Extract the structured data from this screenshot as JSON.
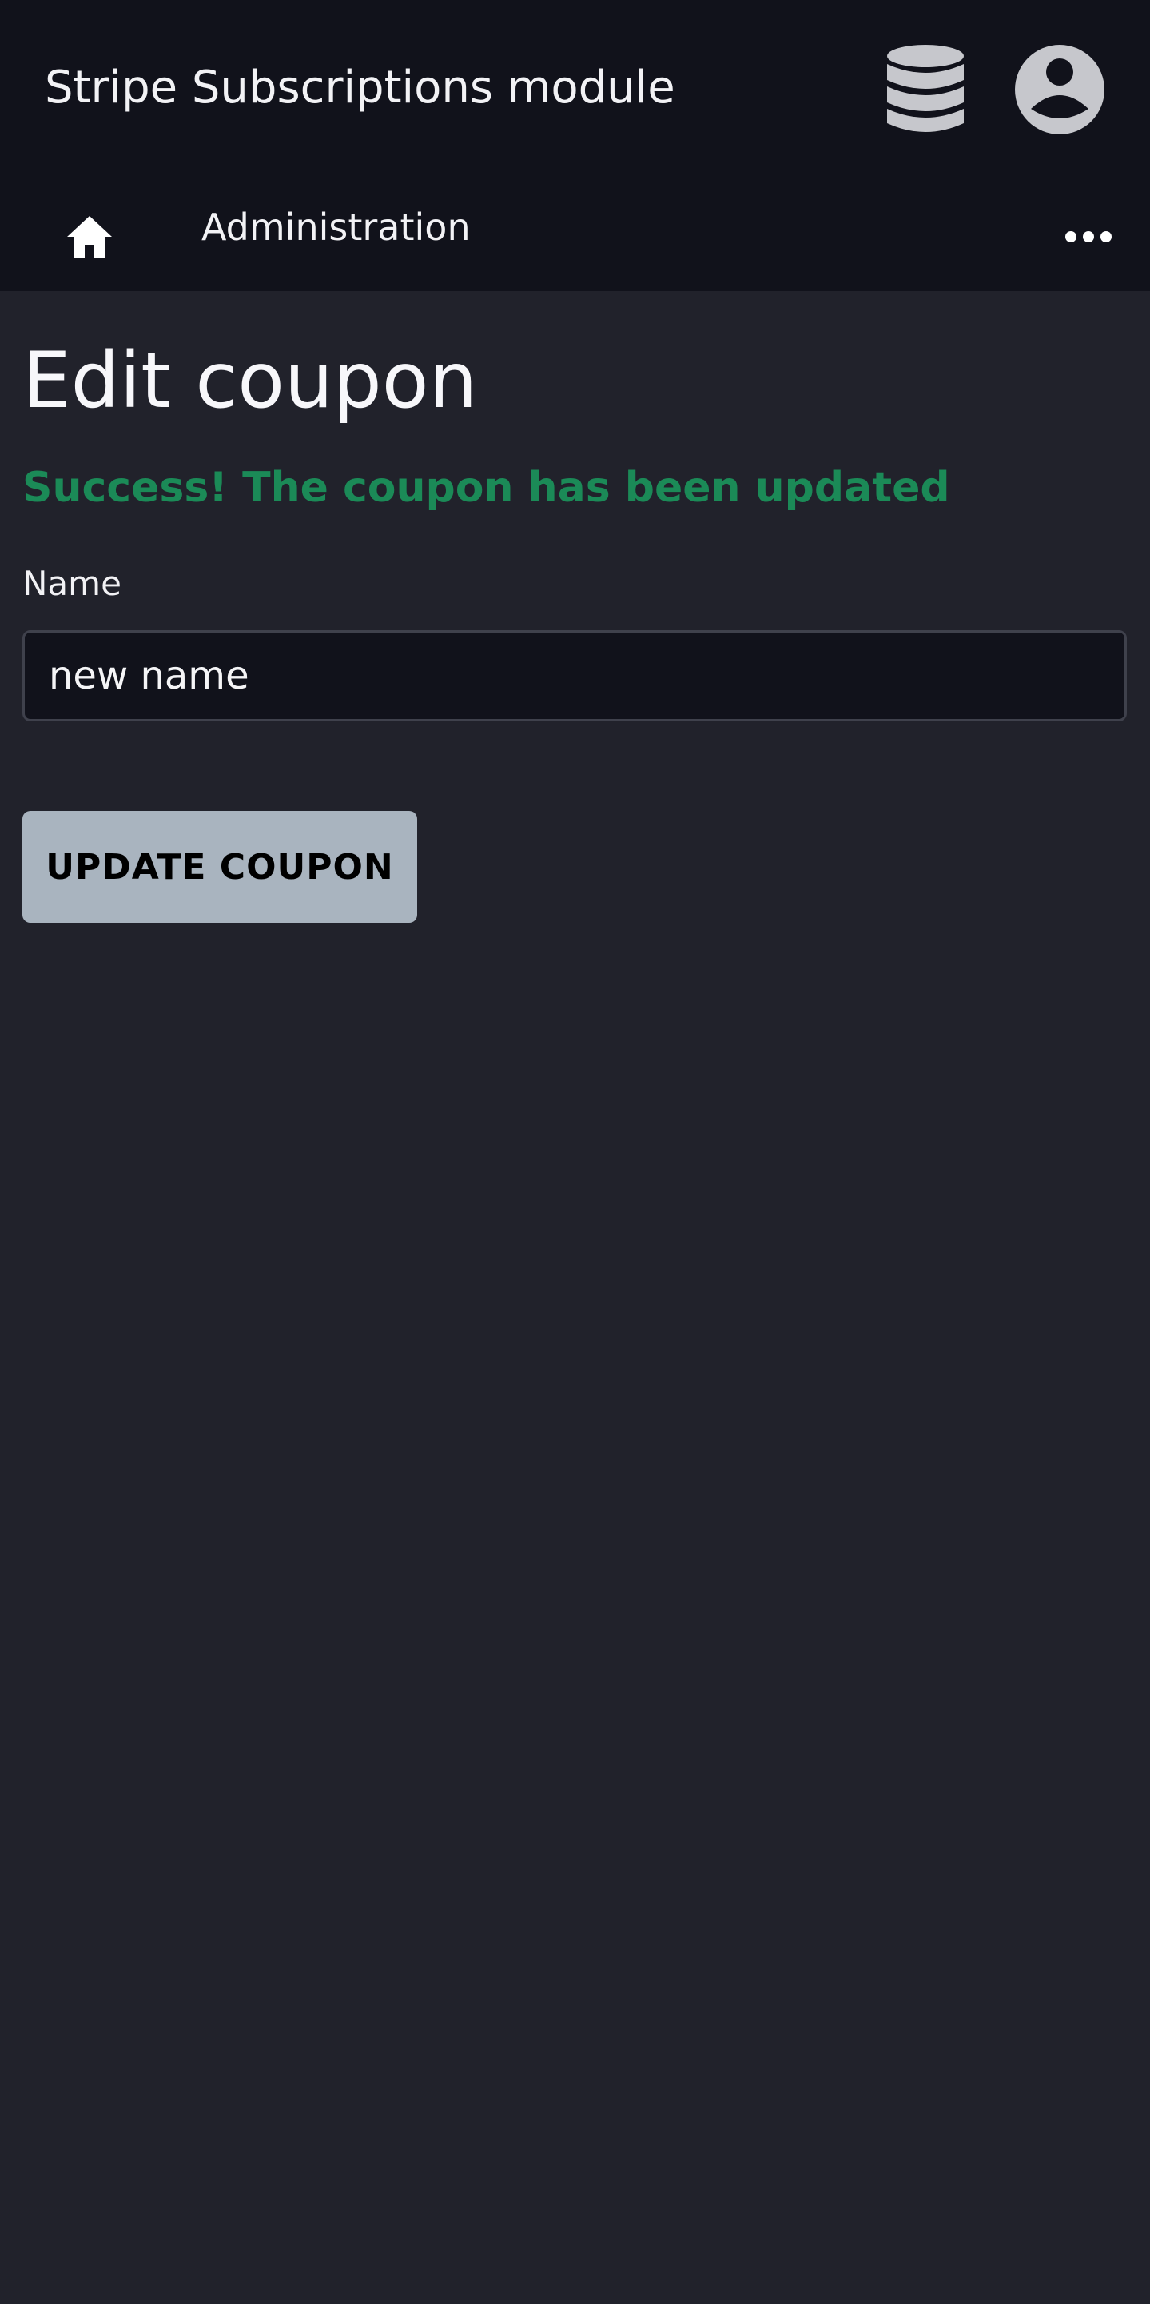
{
  "header": {
    "app_title": "Stripe Subscriptions module",
    "icons": [
      "database-icon",
      "user-account-icon"
    ]
  },
  "nav": {
    "home_icon": "home-icon",
    "admin_label": "Administration",
    "more_icon": "ellipsis-icon"
  },
  "main": {
    "title": "Edit coupon",
    "success_message": "Success! The coupon has been updated",
    "form": {
      "name_label": "Name",
      "name_value": "new name"
    },
    "update_button_label": "UPDATE COUPON"
  },
  "colors": {
    "background": "#21222b",
    "header": "#11121b",
    "success": "#1b8a57",
    "button": "#a9b4bf"
  }
}
